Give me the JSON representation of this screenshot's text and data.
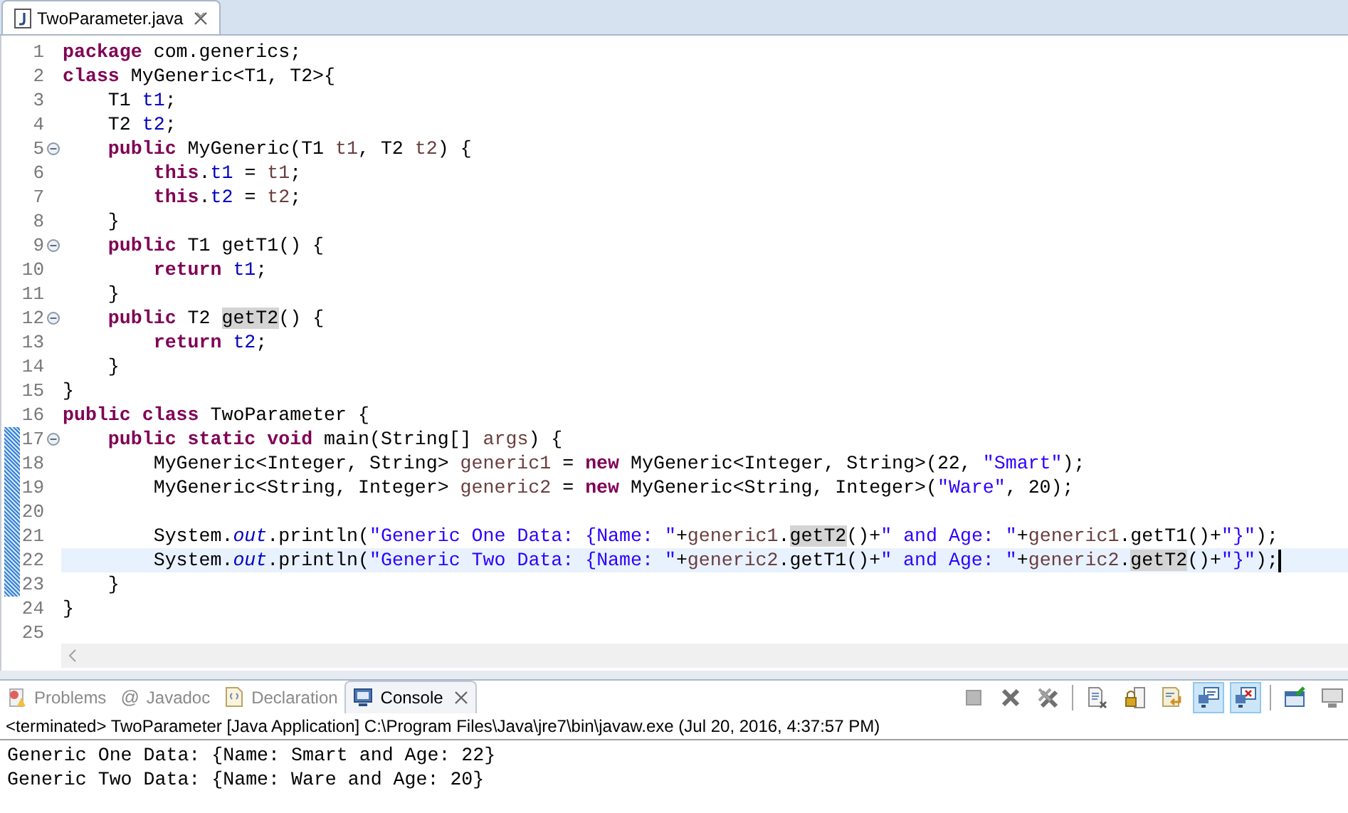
{
  "editor_tab": {
    "title": "TwoParameter.java",
    "selected": true
  },
  "code_lines": [
    {
      "number": "1",
      "tokens": [
        {
          "kind": "kw",
          "text": "package"
        },
        {
          "kind": "plain",
          "text": " com.generics;"
        }
      ]
    },
    {
      "number": "2",
      "tokens": [
        {
          "kind": "kw",
          "text": "class"
        },
        {
          "kind": "plain",
          "text": " MyGeneric<T1, T2>{"
        }
      ]
    },
    {
      "number": "3",
      "tokens": [
        {
          "kind": "plain",
          "text": "    T1 "
        },
        {
          "kind": "field",
          "text": "t1"
        },
        {
          "kind": "plain",
          "text": ";"
        }
      ]
    },
    {
      "number": "4",
      "tokens": [
        {
          "kind": "plain",
          "text": "    T2 "
        },
        {
          "kind": "field",
          "text": "t2"
        },
        {
          "kind": "plain",
          "text": ";"
        }
      ]
    },
    {
      "number": "5",
      "fold": true,
      "tokens": [
        {
          "kind": "kw",
          "text": "    public"
        },
        {
          "kind": "plain",
          "text": " MyGeneric(T1 "
        },
        {
          "kind": "local",
          "text": "t1"
        },
        {
          "kind": "plain",
          "text": ", T2 "
        },
        {
          "kind": "local",
          "text": "t2"
        },
        {
          "kind": "plain",
          "text": ") {"
        }
      ]
    },
    {
      "number": "6",
      "tokens": [
        {
          "kind": "kw",
          "text": "        this"
        },
        {
          "kind": "plain",
          "text": "."
        },
        {
          "kind": "field",
          "text": "t1"
        },
        {
          "kind": "plain",
          "text": " = "
        },
        {
          "kind": "local",
          "text": "t1"
        },
        {
          "kind": "plain",
          "text": ";"
        }
      ]
    },
    {
      "number": "7",
      "tokens": [
        {
          "kind": "kw",
          "text": "        this"
        },
        {
          "kind": "plain",
          "text": "."
        },
        {
          "kind": "field",
          "text": "t2"
        },
        {
          "kind": "plain",
          "text": " = "
        },
        {
          "kind": "local",
          "text": "t2"
        },
        {
          "kind": "plain",
          "text": ";"
        }
      ]
    },
    {
      "number": "8",
      "tokens": [
        {
          "kind": "plain",
          "text": "    }"
        }
      ]
    },
    {
      "number": "9",
      "fold": true,
      "tokens": [
        {
          "kind": "kw",
          "text": "    public"
        },
        {
          "kind": "plain",
          "text": " T1 getT1() {"
        }
      ]
    },
    {
      "number": "10",
      "tokens": [
        {
          "kind": "kw",
          "text": "        return"
        },
        {
          "kind": "field",
          "text": " t1"
        },
        {
          "kind": "plain",
          "text": ";"
        }
      ]
    },
    {
      "number": "11",
      "tokens": [
        {
          "kind": "plain",
          "text": "    }"
        }
      ]
    },
    {
      "number": "12",
      "fold": true,
      "tokens": [
        {
          "kind": "kw",
          "text": "    public"
        },
        {
          "kind": "plain",
          "text": " T2 "
        },
        {
          "kind": "mark",
          "text": "getT2"
        },
        {
          "kind": "plain",
          "text": "() {"
        }
      ]
    },
    {
      "number": "13",
      "tokens": [
        {
          "kind": "kw",
          "text": "        return"
        },
        {
          "kind": "field",
          "text": " t2"
        },
        {
          "kind": "plain",
          "text": ";"
        }
      ]
    },
    {
      "number": "14",
      "tokens": [
        {
          "kind": "plain",
          "text": "    }"
        }
      ]
    },
    {
      "number": "15",
      "tokens": [
        {
          "kind": "plain",
          "text": "}"
        }
      ]
    },
    {
      "number": "16",
      "tokens": [
        {
          "kind": "kw",
          "text": "public"
        },
        {
          "kind": "kw",
          "text": " class"
        },
        {
          "kind": "plain",
          "text": " TwoParameter {"
        }
      ]
    },
    {
      "number": "17",
      "fold": true,
      "changed": true,
      "tokens": [
        {
          "kind": "kw",
          "text": "    public"
        },
        {
          "kind": "kw",
          "text": " static"
        },
        {
          "kind": "kw",
          "text": " void"
        },
        {
          "kind": "plain",
          "text": " main(String[] "
        },
        {
          "kind": "local",
          "text": "args"
        },
        {
          "kind": "plain",
          "text": ") {"
        }
      ]
    },
    {
      "number": "18",
      "changed": true,
      "tokens": [
        {
          "kind": "plain",
          "text": "        MyGeneric<Integer, String> "
        },
        {
          "kind": "local",
          "text": "generic1"
        },
        {
          "kind": "plain",
          "text": " = "
        },
        {
          "kind": "kw",
          "text": "new"
        },
        {
          "kind": "plain",
          "text": " MyGeneric<Integer, String>(22, "
        },
        {
          "kind": "str",
          "text": "\"Smart\""
        },
        {
          "kind": "plain",
          "text": ");"
        }
      ]
    },
    {
      "number": "19",
      "changed": true,
      "tokens": [
        {
          "kind": "plain",
          "text": "        MyGeneric<String, Integer> "
        },
        {
          "kind": "local",
          "text": "generic2"
        },
        {
          "kind": "plain",
          "text": " = "
        },
        {
          "kind": "kw",
          "text": "new"
        },
        {
          "kind": "plain",
          "text": " MyGeneric<String, Integer>("
        },
        {
          "kind": "str",
          "text": "\"Ware\""
        },
        {
          "kind": "plain",
          "text": ", 20);"
        }
      ]
    },
    {
      "number": "20",
      "changed": true
    },
    {
      "number": "21",
      "changed": true,
      "tokens": [
        {
          "kind": "plain",
          "text": "        System."
        },
        {
          "kind": "static",
          "text": "out"
        },
        {
          "kind": "plain",
          "text": ".println("
        },
        {
          "kind": "str",
          "text": "\"Generic One Data: {Name: \""
        },
        {
          "kind": "plain",
          "text": "+"
        },
        {
          "kind": "local",
          "text": "generic1"
        },
        {
          "kind": "plain",
          "text": "."
        },
        {
          "kind": "mark",
          "text": "getT2"
        },
        {
          "kind": "plain",
          "text": "()+"
        },
        {
          "kind": "str",
          "text": "\" and Age: \""
        },
        {
          "kind": "plain",
          "text": "+"
        },
        {
          "kind": "local",
          "text": "generic1"
        },
        {
          "kind": "plain",
          "text": ".getT1()+"
        },
        {
          "kind": "str",
          "text": "\"}\""
        },
        {
          "kind": "plain",
          "text": ");"
        }
      ]
    },
    {
      "number": "22",
      "changed": true,
      "current": true,
      "tokens": [
        {
          "kind": "plain",
          "text": "        System."
        },
        {
          "kind": "static",
          "text": "out"
        },
        {
          "kind": "plain",
          "text": ".println("
        },
        {
          "kind": "str",
          "text": "\"Generic Two Data: {Name: \""
        },
        {
          "kind": "plain",
          "text": "+"
        },
        {
          "kind": "local",
          "text": "generic2"
        },
        {
          "kind": "plain",
          "text": ".getT1()+"
        },
        {
          "kind": "str",
          "text": "\" and Age: \""
        },
        {
          "kind": "plain",
          "text": "+"
        },
        {
          "kind": "local",
          "text": "generic2"
        },
        {
          "kind": "plain",
          "text": "."
        },
        {
          "kind": "mark",
          "text": "getT2"
        },
        {
          "kind": "plain",
          "text": "()+"
        },
        {
          "kind": "str",
          "text": "\"}\""
        },
        {
          "kind": "plain",
          "text": ");"
        }
      ]
    },
    {
      "number": "23",
      "changed": true,
      "tokens": [
        {
          "kind": "plain",
          "text": "    }"
        }
      ]
    },
    {
      "number": "24",
      "tokens": [
        {
          "kind": "plain",
          "text": "}"
        }
      ]
    },
    {
      "number": "25"
    }
  ],
  "console_tabs": [
    {
      "label": "Problems",
      "kind": "problems",
      "selected": false
    },
    {
      "label": "Javadoc",
      "kind": "javadoc",
      "icon_text": "@",
      "selected": false
    },
    {
      "label": "Declaration",
      "kind": "declaration",
      "selected": false
    },
    {
      "label": "Console",
      "kind": "console",
      "selected": true
    }
  ],
  "console_toolbar": [
    {
      "kind": "stop",
      "on": false
    },
    {
      "kind": "remove",
      "on": false
    },
    {
      "kind": "remove-all",
      "on": false
    },
    {
      "kind": "sep"
    },
    {
      "kind": "clear",
      "on": false
    },
    {
      "kind": "lock",
      "on": false
    },
    {
      "kind": "wrap",
      "on": false
    },
    {
      "kind": "out",
      "on": true
    },
    {
      "kind": "err",
      "on": true
    },
    {
      "kind": "sep"
    },
    {
      "kind": "pin",
      "on": false
    },
    {
      "kind": "display",
      "on": false
    }
  ],
  "console_status": "<terminated> TwoParameter [Java Application] C:\\Program Files\\Java\\jre7\\bin\\javaw.exe (Jul 20, 2016, 4:37:57 PM)",
  "console_output": [
    "Generic One Data: {Name: Smart and Age: 22}",
    "Generic Two Data: {Name: Ware and Age: 20}"
  ]
}
